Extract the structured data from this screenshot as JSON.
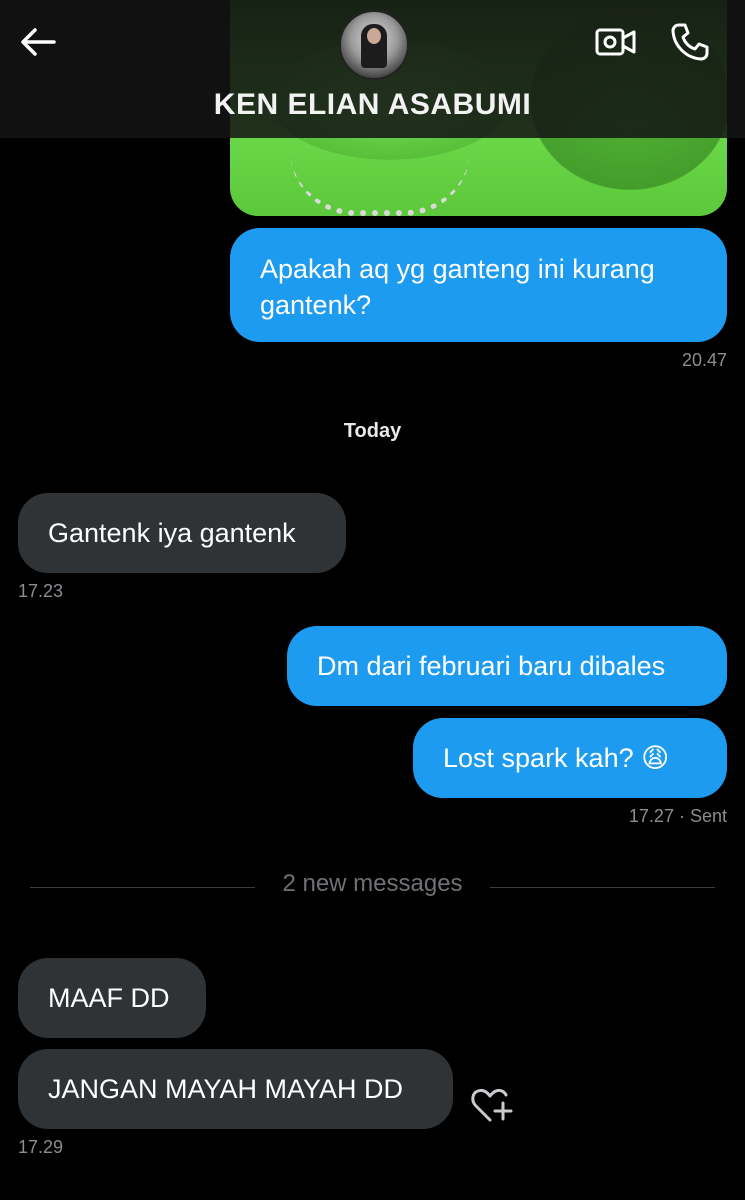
{
  "header": {
    "contact_name": "KEN ELIAN ASABUMI"
  },
  "messages": {
    "m1": {
      "text": "Apakah aq yg ganteng ini kurang gantenk?",
      "time": "20.47"
    },
    "date_separator": "Today",
    "m2": {
      "text": "Gantenk iya gantenk",
      "time": "17.23"
    },
    "m3": {
      "text": "Dm dari februari baru dibales"
    },
    "m4": {
      "text": "Lost spark kah? 😩",
      "time": "17.27",
      "status": "· Sent"
    },
    "new_messages_label": "2 new messages",
    "m5": {
      "text": "MAAF DD"
    },
    "m6": {
      "text": "JANGAN MAYAH MAYAH DD",
      "time": "17.29"
    }
  },
  "colors": {
    "background": "#000000",
    "sent_bubble": "#1d9bf0",
    "received_bubble": "#2f3336",
    "timestamp": "#8a8d91"
  },
  "icons": [
    "back-arrow-icon",
    "video-call-icon",
    "phone-icon",
    "heart-plus-icon"
  ]
}
